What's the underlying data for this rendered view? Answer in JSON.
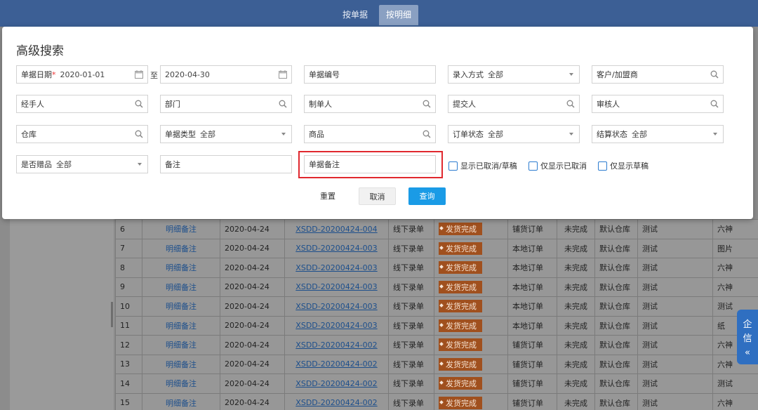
{
  "header": {
    "tabs": [
      {
        "label": "按单据",
        "active": false
      },
      {
        "label": "按明细",
        "active": true
      }
    ]
  },
  "dialog": {
    "title": "高级搜索",
    "fields": {
      "doc_date": {
        "label": "单据日期",
        "required_mark": "*",
        "start": "2020-01-01",
        "separator": "至",
        "end": "2020-04-30"
      },
      "doc_no": {
        "placeholder": "单据编号"
      },
      "entry_method": {
        "label": "录入方式",
        "value": "全部"
      },
      "customer": {
        "placeholder": "客户/加盟商"
      },
      "handler": {
        "placeholder": "经手人"
      },
      "department": {
        "placeholder": "部门"
      },
      "creator": {
        "placeholder": "制单人"
      },
      "submitter": {
        "placeholder": "提交人"
      },
      "reviewer": {
        "placeholder": "审核人"
      },
      "warehouse": {
        "placeholder": "仓库"
      },
      "doc_type": {
        "label": "单据类型",
        "value": "全部"
      },
      "product": {
        "placeholder": "商品"
      },
      "order_status": {
        "label": "订单状态",
        "value": "全部"
      },
      "settle_status": {
        "label": "结算状态",
        "value": "全部"
      },
      "is_gift": {
        "label": "是否赠品",
        "value": "全部"
      },
      "remark": {
        "placeholder": "备注"
      },
      "doc_remark": {
        "placeholder": "单据备注"
      }
    },
    "checkboxes": {
      "show_cancelled_draft": "显示已取消/草稿",
      "only_cancelled": "仅显示已取消",
      "only_draft": "仅显示草稿"
    },
    "buttons": {
      "reset": "重置",
      "cancel": "取消",
      "query": "查询"
    }
  },
  "table": {
    "rows": [
      {
        "no": "6",
        "remark": "明细备注",
        "date": "2020-04-24",
        "order": "XSDD-20200424-004",
        "entry": "线下录单",
        "status": "发货完成",
        "type": "铺货订单",
        "settle": "未完成",
        "warehouse": "默认仓库",
        "creator": "测试",
        "product": "六神"
      },
      {
        "no": "7",
        "remark": "明细备注",
        "date": "2020-04-24",
        "order": "XSDD-20200424-003",
        "entry": "线下录单",
        "status": "发货完成",
        "type": "本地订单",
        "settle": "未完成",
        "warehouse": "默认仓库",
        "creator": "测试",
        "product": "图片"
      },
      {
        "no": "8",
        "remark": "明细备注",
        "date": "2020-04-24",
        "order": "XSDD-20200424-003",
        "entry": "线下录单",
        "status": "发货完成",
        "type": "本地订单",
        "settle": "未完成",
        "warehouse": "默认仓库",
        "creator": "测试",
        "product": "六神"
      },
      {
        "no": "9",
        "remark": "明细备注",
        "date": "2020-04-24",
        "order": "XSDD-20200424-003",
        "entry": "线下录单",
        "status": "发货完成",
        "type": "本地订单",
        "settle": "未完成",
        "warehouse": "默认仓库",
        "creator": "测试",
        "product": "六神"
      },
      {
        "no": "10",
        "remark": "明细备注",
        "date": "2020-04-24",
        "order": "XSDD-20200424-003",
        "entry": "线下录单",
        "status": "发货完成",
        "type": "本地订单",
        "settle": "未完成",
        "warehouse": "默认仓库",
        "creator": "测试",
        "product": "测试"
      },
      {
        "no": "11",
        "remark": "明细备注",
        "date": "2020-04-24",
        "order": "XSDD-20200424-003",
        "entry": "线下录单",
        "status": "发货完成",
        "type": "本地订单",
        "settle": "未完成",
        "warehouse": "默认仓库",
        "creator": "测试",
        "product": "纸"
      },
      {
        "no": "12",
        "remark": "明细备注",
        "date": "2020-04-24",
        "order": "XSDD-20200424-002",
        "entry": "线下录单",
        "status": "发货完成",
        "type": "铺货订单",
        "settle": "未完成",
        "warehouse": "默认仓库",
        "creator": "测试",
        "product": "六神"
      },
      {
        "no": "13",
        "remark": "明细备注",
        "date": "2020-04-24",
        "order": "XSDD-20200424-002",
        "entry": "线下录单",
        "status": "发货完成",
        "type": "铺货订单",
        "settle": "未完成",
        "warehouse": "默认仓库",
        "creator": "测试",
        "product": "六神"
      },
      {
        "no": "14",
        "remark": "明细备注",
        "date": "2020-04-24",
        "order": "XSDD-20200424-002",
        "entry": "线下录单",
        "status": "发货完成",
        "type": "铺货订单",
        "settle": "未完成",
        "warehouse": "默认仓库",
        "creator": "测试",
        "product": "测试"
      },
      {
        "no": "15",
        "remark": "明细备注",
        "date": "2020-04-24",
        "order": "XSDD-20200424-002",
        "entry": "线下录单",
        "status": "发货完成",
        "type": "铺货订单",
        "settle": "未完成",
        "warehouse": "默认仓库",
        "creator": "测试",
        "product": "六神"
      }
    ]
  },
  "side_widget": {
    "line1": "企",
    "line2": "信",
    "arrow": "«"
  }
}
